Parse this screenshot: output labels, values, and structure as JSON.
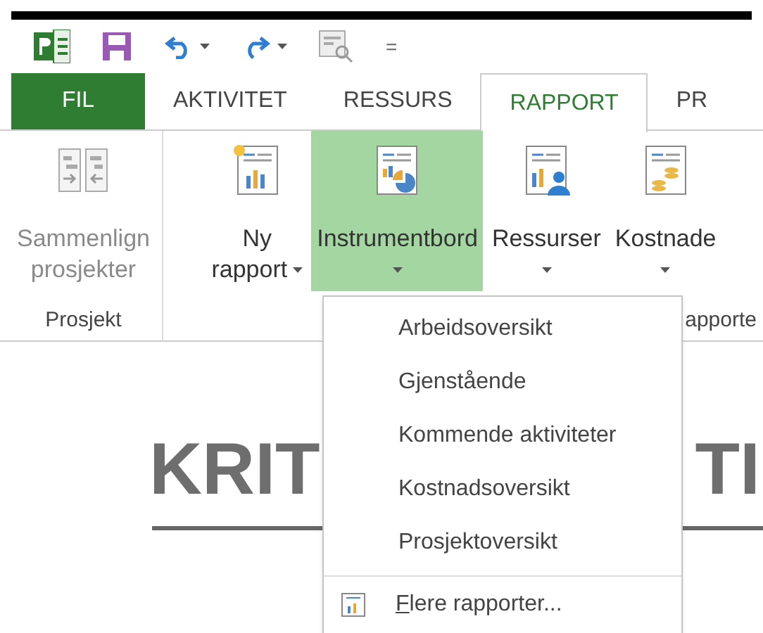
{
  "quick_access": {
    "overflow_glyph": "="
  },
  "tabs": [
    {
      "label": "FIL",
      "kind": "file",
      "selected": false
    },
    {
      "label": "AKTIVITET",
      "kind": "tab",
      "selected": false
    },
    {
      "label": "RESSURS",
      "kind": "tab",
      "selected": false
    },
    {
      "label": "RAPPORT",
      "kind": "tab",
      "selected": true
    },
    {
      "label": "PR",
      "kind": "tab",
      "selected": false
    }
  ],
  "ribbon": {
    "groups": [
      {
        "label": "Prosjekt",
        "buttons": [
          {
            "lines": [
              "Sammenlign",
              "prosjekter"
            ],
            "kind": "plain",
            "disabled": true,
            "selected": false
          }
        ]
      },
      {
        "label": "apporte",
        "buttons": [
          {
            "lines": [
              "Ny",
              "rapport"
            ],
            "kind": "split",
            "disabled": false,
            "selected": false
          },
          {
            "lines": [
              "Instrumentbord"
            ],
            "kind": "menu",
            "disabled": false,
            "selected": true
          },
          {
            "lines": [
              "Ressurser"
            ],
            "kind": "menu",
            "disabled": false,
            "selected": false
          },
          {
            "lines": [
              "Kostnade"
            ],
            "kind": "menu",
            "disabled": false,
            "selected": false
          }
        ]
      }
    ]
  },
  "report_title": {
    "left": "KRIT",
    "right": "TI"
  },
  "menu": {
    "items": [
      {
        "label": "Arbeidsoversikt",
        "kind": "item"
      },
      {
        "label": "Gjenstående",
        "kind": "item"
      },
      {
        "label": "Kommende aktiviteter",
        "kind": "item"
      },
      {
        "label": "Kostnadsoversikt",
        "kind": "item"
      },
      {
        "label": "Prosjektoversikt",
        "kind": "item"
      },
      {
        "label": "Flere rapporter...",
        "kind": "more"
      }
    ]
  }
}
